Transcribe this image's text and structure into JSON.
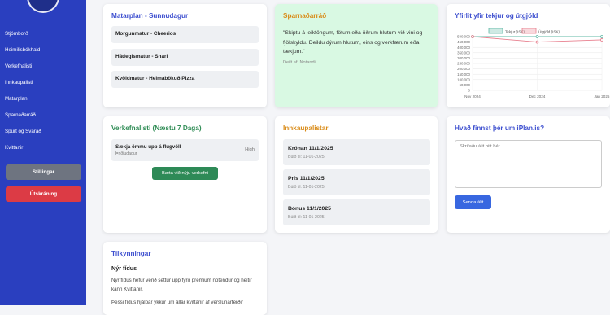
{
  "sidebar": {
    "nav": [
      "Stjórnborð",
      "Heimilisbókhald",
      "Verkefnalisti",
      "Innkaupalisti",
      "Matarplan",
      "Sparnaðarráð",
      "Spurt og Svarað",
      "Kvittanir"
    ],
    "settings_label": "Stillingar",
    "logout_label": "Útskráning"
  },
  "matarplan": {
    "title": "Matarplan - Sunnudagur",
    "items": [
      "Morgunmatur - Cheerios",
      "Hádegismatur - Snarl",
      "Kvöldmatur - Heimabökuð Pizza"
    ]
  },
  "sparnadarrad": {
    "title": "Sparnaðarráð",
    "quote": "\"Skiptu á leikföngum, fötum eða öðrum hlutum við vini og fjölskyldu. Deildu dýrum hlutum, eins og verkfærum eða tækjum.\"",
    "shared_by": "Deilt af: Notandi"
  },
  "yfirlit": {
    "title": "Yfirlit yfir tekjur og útgjöld"
  },
  "chart_data": {
    "type": "line",
    "categories": [
      "Nov 2024",
      "Dec 2024",
      "Jan 2025"
    ],
    "series": [
      {
        "name": "Tekjur (ISK)",
        "values": [
          500000,
          500000,
          500000
        ],
        "color": "#5fb8a6"
      },
      {
        "name": "Útgjöld (ISK)",
        "values": [
          500000,
          450000,
          470000
        ],
        "color": "#e8808f"
      }
    ],
    "y_ticks": [
      "500,000",
      "450,000",
      "400,000",
      "350,000",
      "300,000",
      "250,000",
      "200,000",
      "150,000",
      "100,000",
      "50,000",
      "0"
    ],
    "ylim": [
      0,
      500000
    ],
    "legend": "top"
  },
  "verkefnalisti": {
    "title": "Verkefnalisti (Næstu 7 Daga)",
    "task_title": "Sækja ömmu upp á flugvöll",
    "task_sub": "Þriðjudagur",
    "task_priority": "High",
    "button_label": "Bæta við nýju verkefni"
  },
  "innkaupalistar": {
    "title": "Innkaupalistar",
    "lists": [
      {
        "name": "Krónan 11/1/2025",
        "date": "Búið til: 11-01-2025"
      },
      {
        "name": "Prís 11/1/2025",
        "date": "Búið til: 11-01-2025"
      },
      {
        "name": "Bónus 11/1/2025",
        "date": "Búið til: 11-01-2025"
      }
    ]
  },
  "question": {
    "title": "Hvað finnst þér um iPlan.is?",
    "placeholder": "Skrifaðu álit þitt hér...",
    "send_label": "Senda álit"
  },
  "tilkynningar": {
    "title": "Tilkynningar",
    "subtitle": "Nýr fídus",
    "body": "Nýr fídus hefur verið settur upp fyrir premium notendur og heitir kann Kvittanir.",
    "body2": "Þessi fídus hjálpar ykkur um allar kvittanir af verslunarferðir"
  },
  "colors": {
    "sidebar": "#2a3fbf",
    "title_blue": "#3d4fcf",
    "title_green": "#2f8c55",
    "title_orange": "#d98a16",
    "mint_bg": "#d9f9e3",
    "send_btn": "#3867e0",
    "green_btn": "#2e8a57"
  }
}
